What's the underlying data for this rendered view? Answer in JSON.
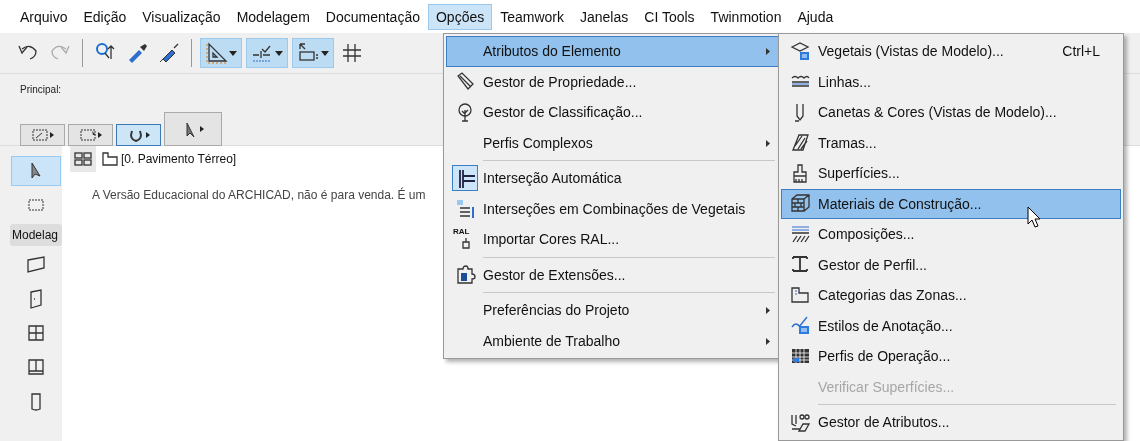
{
  "menubar": [
    {
      "label": "Arquivo",
      "selected": false
    },
    {
      "label": "Edição",
      "selected": false
    },
    {
      "label": "Visualização",
      "selected": false
    },
    {
      "label": "Modelagem",
      "selected": false
    },
    {
      "label": "Documentação",
      "selected": false
    },
    {
      "label": "Opções",
      "selected": true
    },
    {
      "label": "Teamwork",
      "selected": false
    },
    {
      "label": "Janelas",
      "selected": false
    },
    {
      "label": "CI Tools",
      "selected": false
    },
    {
      "label": "Twinmotion",
      "selected": false
    },
    {
      "label": "Ajuda",
      "selected": false
    }
  ],
  "toolbar": [
    {
      "kind": "undo",
      "on": false
    },
    {
      "kind": "redo",
      "on": false
    },
    {
      "kind": "find",
      "on": false
    },
    {
      "kind": "eyedropper",
      "on": false
    },
    {
      "kind": "syringe",
      "on": false
    },
    {
      "kind": "guide",
      "on": true
    },
    {
      "kind": "snap",
      "on": true
    },
    {
      "kind": "coords",
      "on": true
    },
    {
      "kind": "grid",
      "on": false
    }
  ],
  "info_box": {
    "label": "Principal:",
    "tools": [
      {
        "kind": "marquee-arrow",
        "selected": false
      },
      {
        "kind": "marquee",
        "selected": false
      },
      {
        "kind": "magnet",
        "selected": true
      },
      {
        "kind": "pointer",
        "selected": false
      }
    ]
  },
  "toolbox": {
    "items": [
      {
        "kind": "arrow",
        "selected": true
      },
      {
        "kind": "marquee",
        "selected": false
      }
    ],
    "section": "Modelag",
    "tools": [
      {
        "kind": "wall"
      },
      {
        "kind": "door"
      },
      {
        "kind": "window"
      },
      {
        "kind": "skylight"
      },
      {
        "kind": "column"
      }
    ]
  },
  "view": {
    "tab": "[0. Pavimento Térreo]",
    "notice": "A Versão Educacional do ARCHICAD, não é para venda. É um"
  },
  "options_menu": [
    {
      "label": "Atributos do Elemento",
      "kind": "plain",
      "submenu": true,
      "selected": true,
      "checked": false,
      "separator_before": false
    },
    {
      "label": "Gestor de Propriedade...",
      "kind": "tag",
      "submenu": false,
      "selected": false,
      "checked": false,
      "separator_before": false
    },
    {
      "label": "Gestor de Classificação...",
      "kind": "tree",
      "submenu": false,
      "selected": false,
      "checked": false,
      "separator_before": false
    },
    {
      "label": "Perfis Complexos",
      "kind": "plain",
      "submenu": true,
      "selected": false,
      "checked": false,
      "separator_before": false
    },
    {
      "label": "Interseção Automática",
      "kind": "intersect",
      "submenu": false,
      "selected": false,
      "checked": true,
      "separator_before": true
    },
    {
      "label": "Interseções em Combinações de Vegetais",
      "kind": "layers",
      "submenu": false,
      "selected": false,
      "checked": false,
      "separator_before": false
    },
    {
      "label": "Importar Cores RAL...",
      "kind": "ral",
      "icon_label": "RAL",
      "submenu": false,
      "selected": false,
      "checked": false,
      "separator_before": false
    },
    {
      "label": "Gestor de Extensões...",
      "kind": "plugin",
      "submenu": false,
      "selected": false,
      "checked": false,
      "separator_before": true
    },
    {
      "label": "Preferências do Projeto",
      "kind": "plain",
      "submenu": true,
      "selected": false,
      "checked": false,
      "separator_before": true
    },
    {
      "label": "Ambiente de Trabalho",
      "kind": "plain",
      "submenu": true,
      "selected": false,
      "checked": false,
      "separator_before": false
    }
  ],
  "attributes_submenu": [
    {
      "label": "Vegetais (Vistas de Modelo)...",
      "shortcut": "Ctrl+L",
      "kind": "slab",
      "selected": false,
      "disabled": false,
      "separator_before": false
    },
    {
      "label": "Linhas...",
      "kind": "lines",
      "selected": false,
      "disabled": false,
      "separator_before": false
    },
    {
      "label": "Canetas & Cores (Vistas de Modelo)...",
      "kind": "pen",
      "selected": false,
      "disabled": false,
      "separator_before": false
    },
    {
      "label": "Tramas...",
      "kind": "hatch",
      "selected": false,
      "disabled": false,
      "separator_before": false
    },
    {
      "label": "Superfícies...",
      "kind": "brush",
      "selected": false,
      "disabled": false,
      "separator_before": false
    },
    {
      "label": "Materiais de Construção...",
      "kind": "bricks",
      "selected": true,
      "disabled": false,
      "separator_before": false
    },
    {
      "label": "Composições...",
      "kind": "composite",
      "selected": false,
      "disabled": false,
      "separator_before": false
    },
    {
      "label": "Gestor de Perfil...",
      "kind": "profile",
      "selected": false,
      "disabled": false,
      "separator_before": false
    },
    {
      "label": "Categorias das Zonas...",
      "kind": "zone",
      "selected": false,
      "disabled": false,
      "separator_before": false
    },
    {
      "label": "Estilos de Anotação...",
      "kind": "annotation",
      "selected": false,
      "disabled": false,
      "separator_before": false
    },
    {
      "label": "Perfis de Operação...",
      "kind": "table",
      "selected": false,
      "disabled": false,
      "separator_before": false
    },
    {
      "label": "Verificar Superfícies...",
      "kind": "plain",
      "selected": false,
      "disabled": true,
      "separator_before": false
    },
    {
      "label": "Gestor de Atributos...",
      "kind": "attr",
      "selected": false,
      "disabled": false,
      "separator_before": true
    }
  ]
}
